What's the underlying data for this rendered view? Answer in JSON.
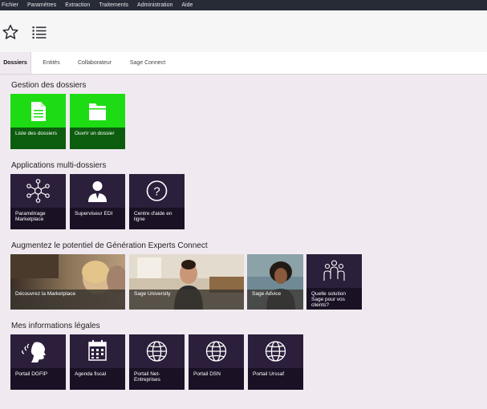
{
  "menu": [
    "Fichier",
    "Paramètres",
    "Extraction",
    "Traitements",
    "Administration",
    "Aide"
  ],
  "toolbar": {
    "favorite_icon": "star-icon",
    "list_icon": "list-icon"
  },
  "tabs": [
    "Dossiers",
    "Entités",
    "Collaborateur",
    "Sage Connect"
  ],
  "sections": {
    "dossiers": {
      "title": "Gestion des dossiers",
      "tiles": [
        {
          "label": "Liste des dossiers",
          "icon": "document-icon"
        },
        {
          "label": "Ouvrir un dossier",
          "icon": "folder-icon"
        }
      ]
    },
    "multi": {
      "title": "Applications multi-dossiers",
      "tiles": [
        {
          "label": "Paramétrage Marketplace",
          "icon": "network-icon"
        },
        {
          "label": "Superviseur EDI",
          "icon": "supervisor-icon"
        },
        {
          "label": "Centre d'aide en ligne",
          "icon": "help-icon"
        }
      ]
    },
    "augment": {
      "title": "Augmentez le potentiel de Génération Experts Connect",
      "tiles": [
        {
          "label": "Découvrez la Marketplace",
          "icon": "photo-marketplace"
        },
        {
          "label": "Sage University",
          "icon": "photo-university"
        },
        {
          "label": "Sage Advice",
          "icon": "photo-advice"
        },
        {
          "label": "Quelle solution Sage pour vos clients?",
          "icon": "people-icon"
        }
      ]
    },
    "legal": {
      "title": "Mes informations légales",
      "tiles": [
        {
          "label": "Portail DGFIP",
          "icon": "marianne-icon"
        },
        {
          "label": "Agenda fiscal",
          "icon": "calendar-icon"
        },
        {
          "label": "Portail Net-Entreprises",
          "icon": "globe-icon"
        },
        {
          "label": "Portail DSN",
          "icon": "globe-icon"
        },
        {
          "label": "Portail Urssaf",
          "icon": "globe-icon"
        }
      ]
    }
  },
  "colors": {
    "menubar": "#262b36",
    "green_tile": "#1ddc14",
    "green_band": "#0d5d0e",
    "dark_tile": "#2b1f3b",
    "page_bg": "#f0eaf0"
  }
}
